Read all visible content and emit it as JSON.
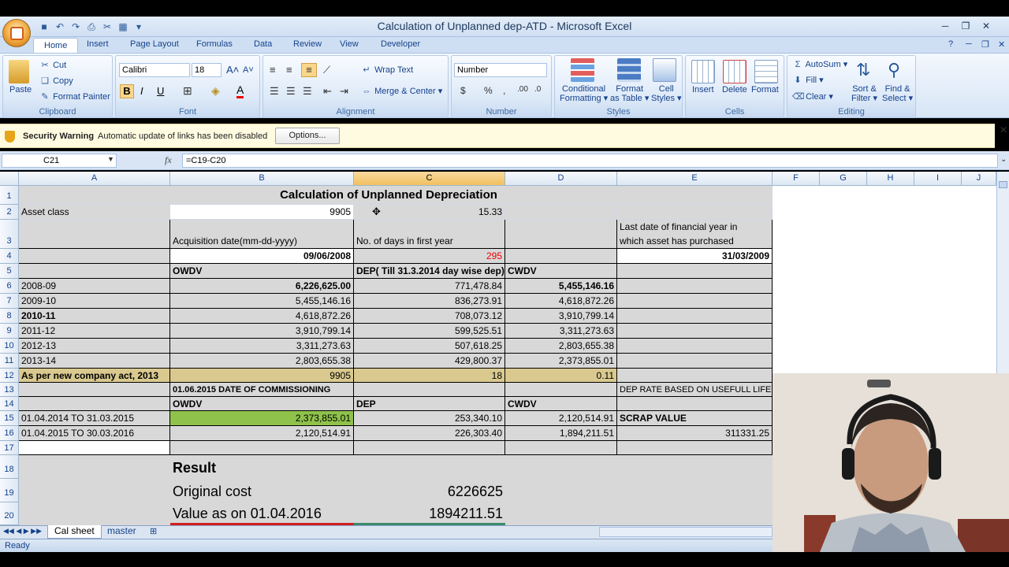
{
  "window": {
    "title": "Calculation of Unplanned dep-ATD - Microsoft Excel"
  },
  "ribbon_tabs": [
    "Home",
    "Insert",
    "Page Layout",
    "Formulas",
    "Data",
    "Review",
    "View",
    "Developer"
  ],
  "clipboard": {
    "paste": "Paste",
    "cut": "Cut",
    "copy": "Copy",
    "format_painter": "Format Painter",
    "label": "Clipboard"
  },
  "font": {
    "name": "Calibri",
    "size": "18",
    "label": "Font"
  },
  "alignment": {
    "wrap": "Wrap Text",
    "merge": "Merge & Center",
    "label": "Alignment"
  },
  "number": {
    "format": "Number",
    "label": "Number",
    "dollar": "$",
    "percent": "%",
    "comma": ","
  },
  "styles": {
    "conditional": "Conditional",
    "conditional2": "Formatting",
    "format_table": "Format",
    "format_table2": "as Table",
    "cell_styles": "Cell",
    "cell_styles2": "Styles",
    "label": "Styles"
  },
  "cells": {
    "insert": "Insert",
    "delete": "Delete",
    "format": "Format",
    "label": "Cells"
  },
  "editing": {
    "autosum": "AutoSum",
    "fill": "Fill",
    "clear": "Clear",
    "sort": "Sort &",
    "sort2": "Filter",
    "find": "Find &",
    "find2": "Select",
    "label": "Editing"
  },
  "security": {
    "title": "Security Warning",
    "message": "Automatic update of links has been disabled",
    "options": "Options..."
  },
  "formula_bar": {
    "name_box": "C21",
    "fx": "fx",
    "formula": "=C19-C20"
  },
  "columns": [
    "A",
    "B",
    "C",
    "D",
    "E",
    "F",
    "G",
    "H",
    "I",
    "J"
  ],
  "rows": [
    "1",
    "2",
    "3",
    "4",
    "5",
    "6",
    "7",
    "8",
    "9",
    "10",
    "11",
    "12",
    "13",
    "14",
    "15",
    "16",
    "17",
    "18",
    "19",
    "20"
  ],
  "sheet": {
    "title": "Calculation of Unplanned Depreciation",
    "a2": "Asset class",
    "b2": "9905",
    "c2": "15.33",
    "b3": "Acquisition date(mm-dd-yyyy)",
    "c3": "No. of days  in first year",
    "e3a": "Last date of financial year in",
    "e3b": "which asset has purchased",
    "b4": "09/06/2008",
    "c4": "295",
    "e4": "31/03/2009",
    "b5": "OWDV",
    "c5": "DEP( Till 31.3.2014 day wise dep)",
    "d5": "CWDV",
    "data_rows": [
      {
        "a": "2008-09",
        "b": "6,226,625.00",
        "c": "771,478.84",
        "d": "5,455,146.16"
      },
      {
        "a": "2009-10",
        "b": "5,455,146.16",
        "c": "836,273.91",
        "d": "4,618,872.26"
      },
      {
        "a": "2010-11",
        "b": "4,618,872.26",
        "c": "708,073.12",
        "d": "3,910,799.14"
      },
      {
        "a": "2011-12",
        "b": "3,910,799.14",
        "c": "599,525.51",
        "d": "3,311,273.63"
      },
      {
        "a": "2012-13",
        "b": "3,311,273.63",
        "c": "507,618.25",
        "d": "2,803,655.38"
      },
      {
        "a": "2013-14",
        "b": "2,803,655.38",
        "c": "429,800.37",
        "d": "2,373,855.01"
      }
    ],
    "a12": "As per new company act, 2013",
    "b12": "9905",
    "c12": "18",
    "d12": "0.11",
    "b13": "01.06.2015 DATE OF COMMISSIONING",
    "e13": "DEP RATE BASED ON USEFULL LIFE",
    "b14": "OWDV",
    "c14": "DEP",
    "d14": "CWDV",
    "a15": "01.04.2014 TO 31.03.2015",
    "b15": "2,373,855.01",
    "c15": "253,340.10",
    "d15": "2,120,514.91",
    "e15": "SCRAP VALUE",
    "a16": "01.04.2015 TO 30.03.2016",
    "b16": "2,120,514.91",
    "c16": "226,303.40",
    "d16": "1,894,211.51",
    "e16": "311331.25",
    "result": "Result",
    "orig_label": "Original cost",
    "orig_value": "6226625",
    "val_label": "Value as on 01.04.2016",
    "val_value": "1894211.51"
  },
  "sheet_tabs": [
    "Cal sheet",
    "master"
  ],
  "status": "Ready"
}
